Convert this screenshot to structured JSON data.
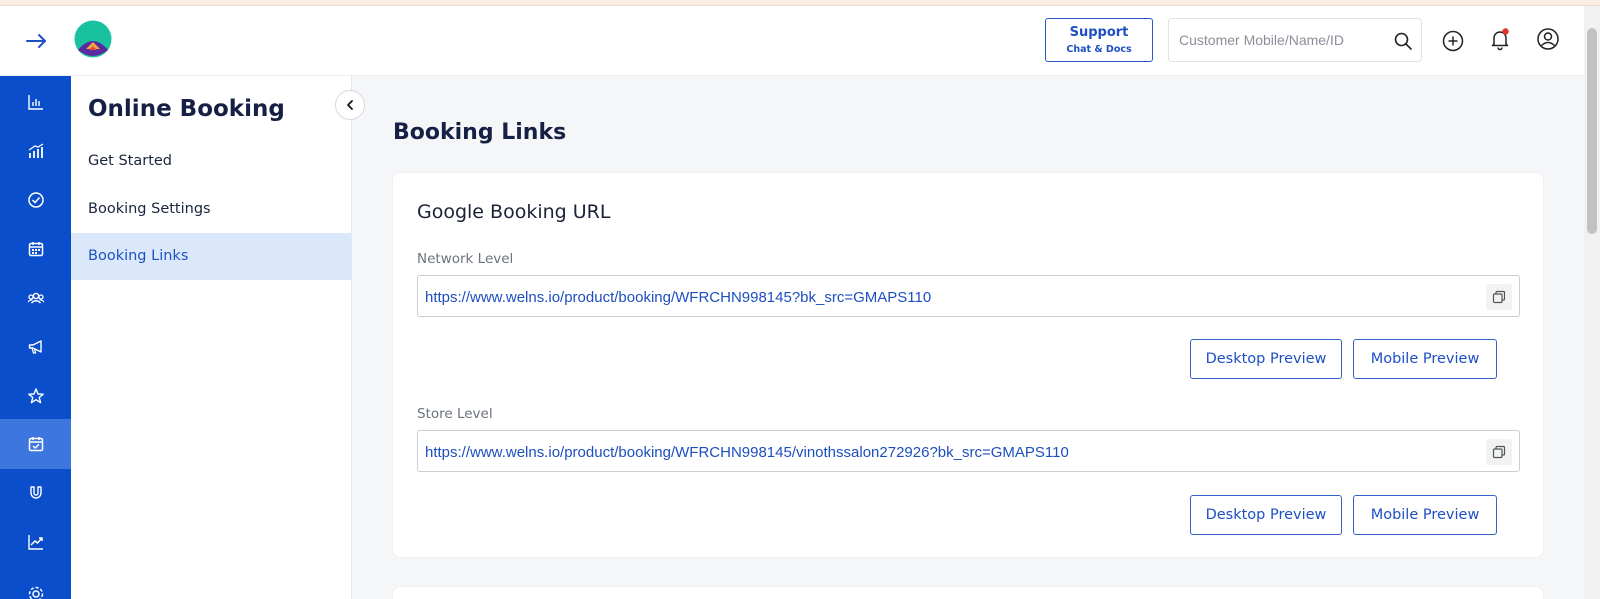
{
  "header": {
    "support": {
      "title": "Support",
      "subtitle": "Chat & Docs"
    },
    "search": {
      "placeholder": "Customer Mobile/Name/ID",
      "value": ""
    }
  },
  "rail": {
    "items": [
      {
        "icon": "bar-chart-icon"
      },
      {
        "icon": "growth-chart-icon"
      },
      {
        "icon": "check-circle-icon"
      },
      {
        "icon": "calendar-icon"
      },
      {
        "icon": "customers-icon"
      },
      {
        "icon": "megaphone-icon"
      },
      {
        "icon": "star-icon"
      },
      {
        "icon": "calendar-check-icon",
        "active": true
      },
      {
        "icon": "magnet-icon"
      },
      {
        "icon": "trend-line-icon"
      }
    ]
  },
  "subnav": {
    "title": "Online Booking",
    "items": [
      {
        "label": "Get Started"
      },
      {
        "label": "Booking Settings"
      },
      {
        "label": "Booking Links",
        "active": true
      }
    ]
  },
  "main": {
    "title": "Booking Links",
    "card": {
      "title": "Google Booking URL",
      "network": {
        "label": "Network Level",
        "url": "https://www.welns.io/product/booking/WFRCHN998145?bk_src=GMAPS110",
        "desktop_label": "Desktop Preview",
        "mobile_label": "Mobile Preview"
      },
      "store": {
        "label": "Store Level",
        "url": "https://www.welns.io/product/booking/WFRCHN998145/vinothssalon272926?bk_src=GMAPS110",
        "desktop_label": "Desktop Preview",
        "mobile_label": "Mobile Preview"
      }
    }
  },
  "colors": {
    "rail": "#0b4ecb",
    "rail_active": "#3d76df",
    "accent": "#1e4fc6",
    "active_subnav": "#dbe8fb"
  }
}
